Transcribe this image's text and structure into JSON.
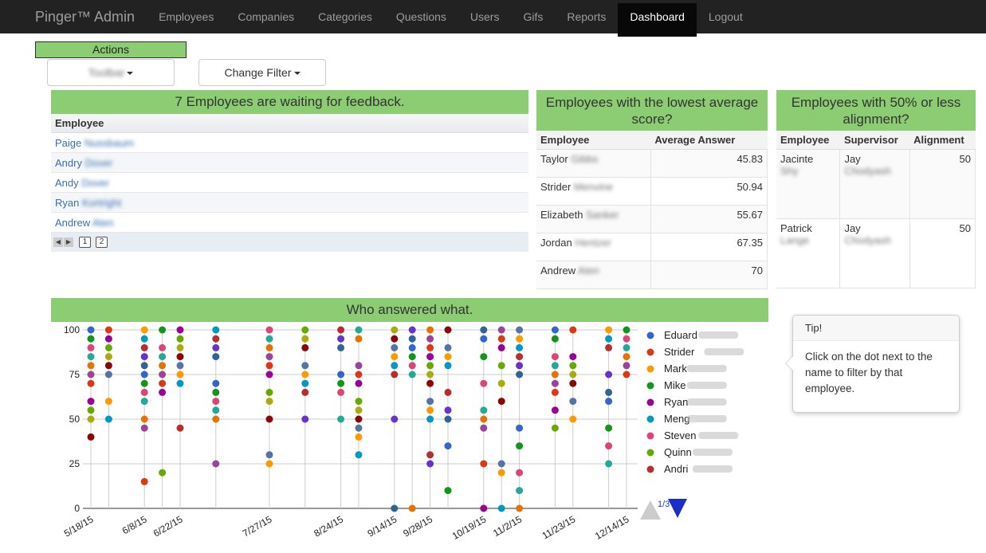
{
  "navbar": {
    "brand": "Pinger™ Admin",
    "items": [
      "Employees",
      "Companies",
      "Categories",
      "Questions",
      "Users",
      "Gifs",
      "Reports",
      "Dashboard",
      "Logout"
    ],
    "active": "Dashboard"
  },
  "actions": {
    "label": "Actions",
    "company_button": "Toolbar",
    "filter_button": "Change Filter"
  },
  "feedback": {
    "title": "7 Employees are waiting for feedback.",
    "column": "Employee",
    "rows": [
      {
        "first": "Paige",
        "rest": "Nussbaum"
      },
      {
        "first": "Andry",
        "rest": "Dover"
      },
      {
        "first": "Andy",
        "rest": "Dover"
      },
      {
        "first": "Ryan",
        "rest": "Kortright"
      },
      {
        "first": "Andrew",
        "rest": "Aten"
      }
    ],
    "pages": [
      "1",
      "2"
    ]
  },
  "lowest": {
    "title": "Employees with the lowest average score?",
    "columns": [
      "Employee",
      "Average Answer"
    ],
    "rows": [
      {
        "first": "Taylor",
        "rest": "Gibbs",
        "score": "45.83"
      },
      {
        "first": "Strider",
        "rest": "Menvine",
        "score": "50.94"
      },
      {
        "first": "Elizabeth",
        "rest": "Sanker",
        "score": "55.67"
      },
      {
        "first": "Jordan",
        "rest": "Hentzer",
        "score": "67.35"
      },
      {
        "first": "Andrew",
        "rest": "Aten",
        "score": "70"
      }
    ]
  },
  "alignment": {
    "title": "Employees with 50% or less alignment?",
    "columns": [
      "Employee",
      "Supervisor",
      "Alignment"
    ],
    "rows": [
      {
        "employee_first": "Jacinte",
        "employee_rest": "Shy",
        "sup_first": "Jay",
        "sup_rest": "Chodyash",
        "value": "50"
      },
      {
        "employee_first": "Patrick",
        "employee_rest": "Lange",
        "sup_first": "Jay",
        "sup_rest": "Chodyash",
        "value": "50"
      }
    ]
  },
  "tip": {
    "title": "Tip!",
    "body": "Click on the dot next to the name to filter by that employee."
  },
  "chart_data": {
    "type": "scatter",
    "title": "Who answered what.",
    "ylim": [
      0,
      100
    ],
    "yticks": [
      0,
      25,
      50,
      75,
      100
    ],
    "x_tick_labels": [
      "5/18/15",
      "6/8/15",
      "6/22/15",
      "7/27/15",
      "8/24/15",
      "9/14/15",
      "9/28/15",
      "10/19/15",
      "11/2/15",
      "11/23/15",
      "12/14/15"
    ],
    "legend_page": "1/3",
    "series": [
      {
        "name": "Eduard",
        "color": "#3366cc"
      },
      {
        "name": "Strider",
        "color": "#dc3912"
      },
      {
        "name": "Mark",
        "color": "#ff9900"
      },
      {
        "name": "Mike",
        "color": "#109618"
      },
      {
        "name": "Ryan",
        "color": "#990099"
      },
      {
        "name": "Meng",
        "color": "#0099c6"
      },
      {
        "name": "Steven",
        "color": "#dd4477"
      },
      {
        "name": "Quinn",
        "color": "#66aa00"
      },
      {
        "name": "Andri",
        "color": "#b82e2e"
      }
    ],
    "columns": [
      {
        "date": "5/18/15",
        "values": [
          100,
          95,
          90,
          85,
          80,
          75,
          70,
          60,
          55,
          50,
          40
        ]
      },
      {
        "date": "5/25/15",
        "values": [
          100,
          95,
          90,
          85,
          80,
          75,
          60,
          50
        ]
      },
      {
        "date": "6/8/15",
        "values": [
          100,
          95,
          90,
          85,
          80,
          75,
          70,
          65,
          60,
          50,
          45,
          15
        ]
      },
      {
        "date": "6/15/15",
        "values": [
          100,
          90,
          85,
          80,
          75,
          70,
          65,
          20
        ]
      },
      {
        "date": "6/22/15",
        "values": [
          100,
          95,
          90,
          85,
          80,
          75,
          70,
          45
        ]
      },
      {
        "date": "7/6/15",
        "values": [
          100,
          95,
          90,
          85,
          70,
          65,
          60,
          55,
          50,
          25
        ]
      },
      {
        "date": "7/27/15",
        "values": [
          100,
          95,
          90,
          85,
          80,
          75,
          65,
          60,
          50,
          30,
          25
        ]
      },
      {
        "date": "8/10/15",
        "values": [
          100,
          95,
          90,
          80,
          75,
          70,
          65,
          50
        ]
      },
      {
        "date": "8/24/15",
        "values": [
          100,
          95,
          90,
          75,
          70,
          65,
          50
        ]
      },
      {
        "date": "8/31/15",
        "values": [
          100,
          95,
          80,
          75,
          70,
          60,
          55,
          50,
          45,
          40,
          30
        ]
      },
      {
        "date": "9/14/15",
        "values": [
          100,
          95,
          90,
          85,
          80,
          75,
          50,
          0
        ]
      },
      {
        "date": "9/21/15",
        "values": [
          100,
          95,
          90,
          85,
          80,
          75,
          0
        ]
      },
      {
        "date": "9/28/15",
        "values": [
          100,
          95,
          90,
          85,
          80,
          75,
          70,
          60,
          55,
          50,
          30,
          25
        ]
      },
      {
        "date": "10/5/15",
        "values": [
          100,
          90,
          85,
          80,
          65,
          55,
          50,
          35,
          10
        ]
      },
      {
        "date": "10/19/15",
        "values": [
          100,
          95,
          85,
          70,
          55,
          50,
          45,
          25,
          0
        ]
      },
      {
        "date": "10/26/15",
        "values": [
          100,
          95,
          90,
          80,
          70,
          60,
          25,
          20,
          0
        ]
      },
      {
        "date": "11/2/15",
        "values": [
          100,
          95,
          90,
          85,
          80,
          75,
          45,
          35,
          20,
          10,
          0
        ]
      },
      {
        "date": "11/16/15",
        "values": [
          100,
          95,
          85,
          80,
          75,
          70,
          65,
          55,
          45
        ]
      },
      {
        "date": "11/23/15",
        "values": [
          100,
          85,
          80,
          75,
          70,
          60,
          50
        ]
      },
      {
        "date": "12/7/15",
        "values": [
          100,
          95,
          90,
          75,
          65,
          60,
          45,
          35,
          25
        ]
      },
      {
        "date": "12/14/15",
        "values": [
          100,
          95,
          90,
          85,
          80,
          75
        ]
      }
    ]
  }
}
